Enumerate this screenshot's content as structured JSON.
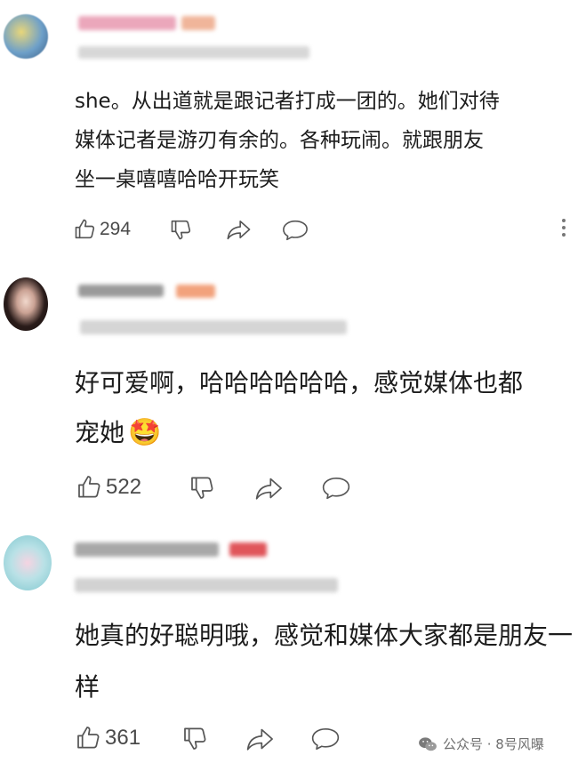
{
  "comments": [
    {
      "text_lines": [
        "she。从出道就是跟记者打成一团的。她们对待",
        "媒体记者是游刃有余的。各种玩闹。就跟朋友",
        "坐一桌嘻嘻哈哈开玩笑"
      ],
      "likes": "294"
    },
    {
      "text_lines": [
        "好可爱啊，哈哈哈哈哈哈，感觉媒体也都",
        "宠她"
      ],
      "emoji": "🤩",
      "likes": "522"
    },
    {
      "text_lines": [
        "她真的好聪明哦，感觉和媒体大家都是朋友一",
        "样"
      ],
      "likes": "361"
    }
  ],
  "watermark": {
    "text": "公众号 · 8号风曝",
    "icon": "wechat-icon"
  },
  "icons": {
    "like": "thumbs-up-icon",
    "dislike": "thumbs-down-icon",
    "share": "share-arrow-icon",
    "reply": "speech-bubble-icon",
    "more": "more-vertical-icon"
  },
  "colors": {
    "text": "#1c1c1c",
    "icon": "#555555",
    "username_blur": "#e9a3b8",
    "badge_blur": "#f4a07a",
    "badge_red_blur": "#e0464b"
  }
}
